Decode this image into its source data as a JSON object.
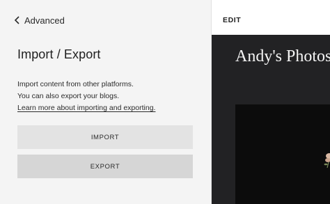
{
  "nav": {
    "back_label": "Advanced"
  },
  "panel": {
    "title": "Import / Export",
    "description_line1": "Import content from other platforms.",
    "description_line2": "You can also export your blogs.",
    "learn_more_link": "Learn more about importing and exporting."
  },
  "buttons": {
    "import_label": "IMPORT",
    "export_label": "EXPORT"
  },
  "preview": {
    "edit_label": "EDIT",
    "site_title": "Andy's Photos"
  },
  "colors": {
    "panel_bg": "#f4f4f4",
    "import_button_bg": "#e3e3e3",
    "export_button_bg": "#d6d6d6",
    "preview_bg": "#222224",
    "hero_bg": "#0c0c0c"
  },
  "icons": {
    "back": "chevron-left-icon"
  }
}
